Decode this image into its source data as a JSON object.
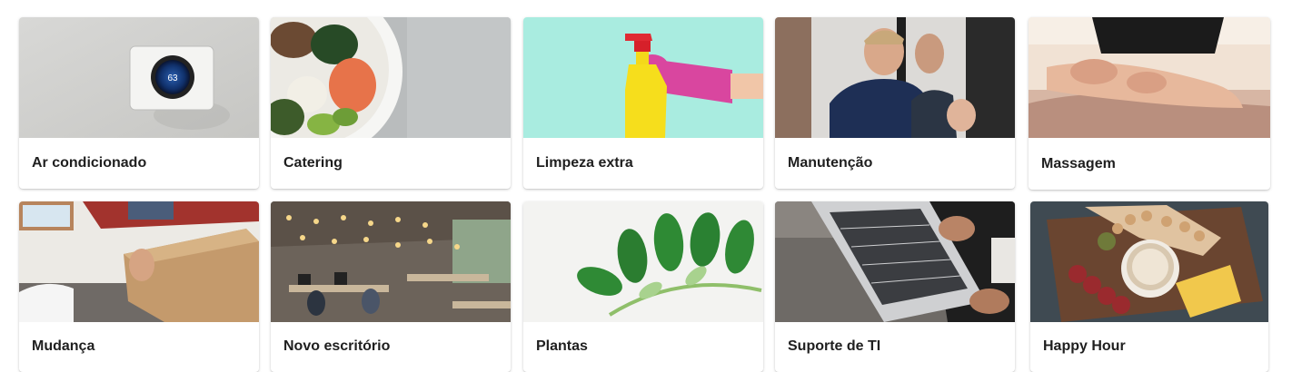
{
  "services": [
    {
      "label": "Ar condicionado",
      "image": "thermostat-photo"
    },
    {
      "label": "Catering",
      "image": "food-bowl-photo"
    },
    {
      "label": "Limpeza extra",
      "image": "spray-bottle-photo"
    },
    {
      "label": "Manutenção",
      "image": "maintenance-worker-photo"
    },
    {
      "label": "Massagem",
      "image": "massage-photo"
    },
    {
      "label": "Mudança",
      "image": "moving-box-photo"
    },
    {
      "label": "Novo escritório",
      "image": "office-space-photo"
    },
    {
      "label": "Plantas",
      "image": "plant-branch-photo"
    },
    {
      "label": "Suporte de TI",
      "image": "laptop-photo"
    },
    {
      "label": "Happy Hour",
      "image": "drinks-board-photo"
    }
  ],
  "thermostat_display": "63"
}
